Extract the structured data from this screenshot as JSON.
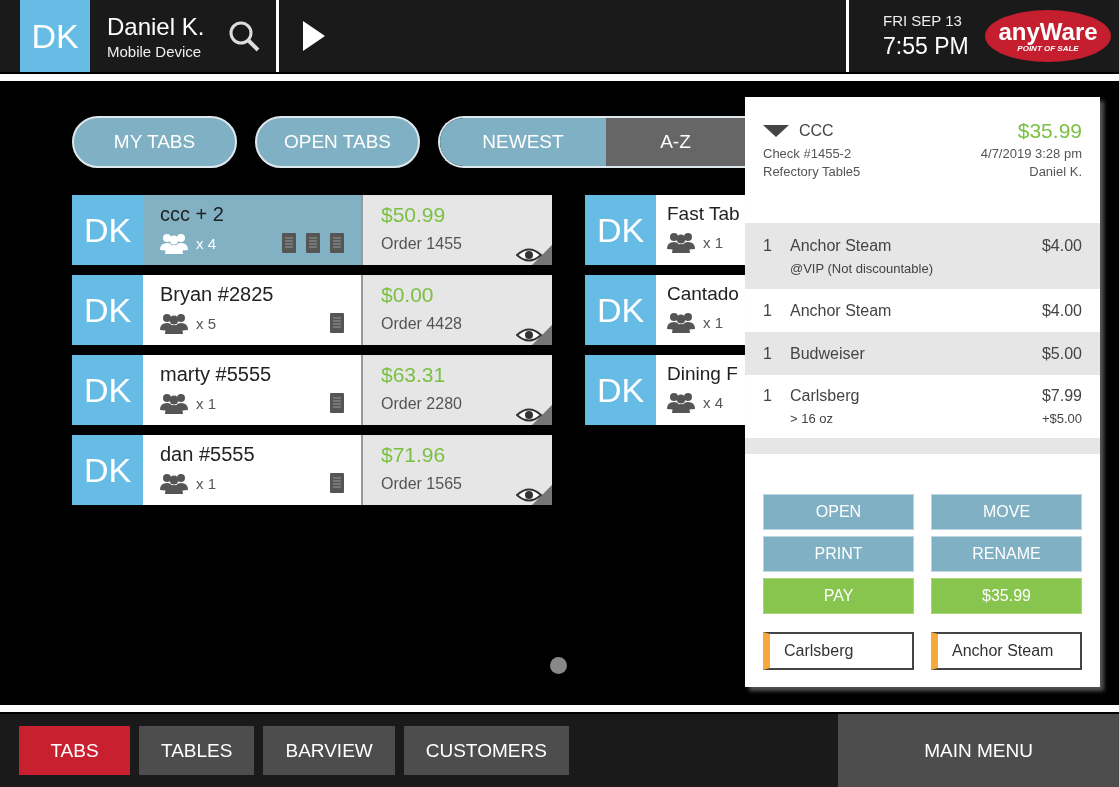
{
  "header": {
    "avatar": "DK",
    "user_name": "Daniel K.",
    "device": "Mobile Device",
    "date": "FRI SEP 13",
    "time": "7:55 PM",
    "logo": {
      "name": "anyWare",
      "tagline": "POINT OF SALE"
    }
  },
  "filters": [
    {
      "label": "MY TABS"
    },
    {
      "label": "OPEN TABS"
    }
  ],
  "sort": [
    {
      "label": "NEWEST",
      "selected": false
    },
    {
      "label": "A-Z",
      "selected": true
    }
  ],
  "tabs_left": [
    {
      "avatar": "DK",
      "name": "ccc + 2",
      "guests": "x 4",
      "selected": true,
      "checks": [
        {
          "kind": "check"
        },
        {
          "kind": "check"
        },
        {
          "kind": "check"
        }
      ],
      "total": "$50.99",
      "order": "Order 1455"
    },
    {
      "avatar": "DK",
      "name": "Bryan #2825",
      "guests": "x 5",
      "selected": false,
      "checks": [
        {
          "kind": "check"
        }
      ],
      "total": "$0.00",
      "order": "Order 4428"
    },
    {
      "avatar": "DK",
      "name": "marty #5555",
      "guests": "x 1",
      "selected": false,
      "checks": [
        {
          "kind": "check"
        }
      ],
      "total": "$63.31",
      "order": "Order 2280"
    },
    {
      "avatar": "DK",
      "name": "dan #5555",
      "guests": "x 1",
      "selected": false,
      "checks": [
        {
          "kind": "check"
        }
      ],
      "total": "$71.96",
      "order": "Order 1565"
    }
  ],
  "tabs_right": [
    {
      "avatar": "DK",
      "name": "Fast Tab",
      "guests": "x 1"
    },
    {
      "avatar": "DK",
      "name": "Cantado",
      "guests": "x 1"
    },
    {
      "avatar": "DK",
      "name": "Dining F",
      "guests": "x 4"
    }
  ],
  "check_panel": {
    "name": "CCC",
    "total": "$35.99",
    "check": "Check #1455-2",
    "datetime": "4/7/2019 3:28 pm",
    "table": "Refectory Table5",
    "server": "Daniel K.",
    "items": [
      {
        "qty": "1",
        "name": "Anchor Steam",
        "price": "$4.00",
        "modifier": "@VIP (Not discountable)"
      },
      {
        "qty": "1",
        "name": "Anchor Steam",
        "price": "$4.00"
      },
      {
        "qty": "1",
        "name": "Budweiser",
        "price": "$5.00"
      },
      {
        "qty": "1",
        "name": "Carlsberg",
        "price": "$7.99",
        "modifier": "> 16 oz",
        "modifier_price": "+$5.00"
      }
    ],
    "actions": [
      {
        "label": "OPEN",
        "kind": "action"
      },
      {
        "label": "MOVE",
        "kind": "action"
      },
      {
        "label": "PRINT",
        "kind": "action"
      },
      {
        "label": "RENAME",
        "kind": "action"
      },
      {
        "label": "PAY",
        "kind": "pay"
      },
      {
        "label": "$35.99",
        "kind": "pay"
      }
    ],
    "quick_items": [
      "Carlsberg",
      "Anchor Steam"
    ]
  },
  "bottom_nav": [
    {
      "label": "TABS",
      "selected": true
    },
    {
      "label": "TABLES",
      "selected": false
    },
    {
      "label": "BARVIEW",
      "selected": false
    },
    {
      "label": "CUSTOMERS",
      "selected": false
    }
  ],
  "main_menu": "MAIN MENU"
}
